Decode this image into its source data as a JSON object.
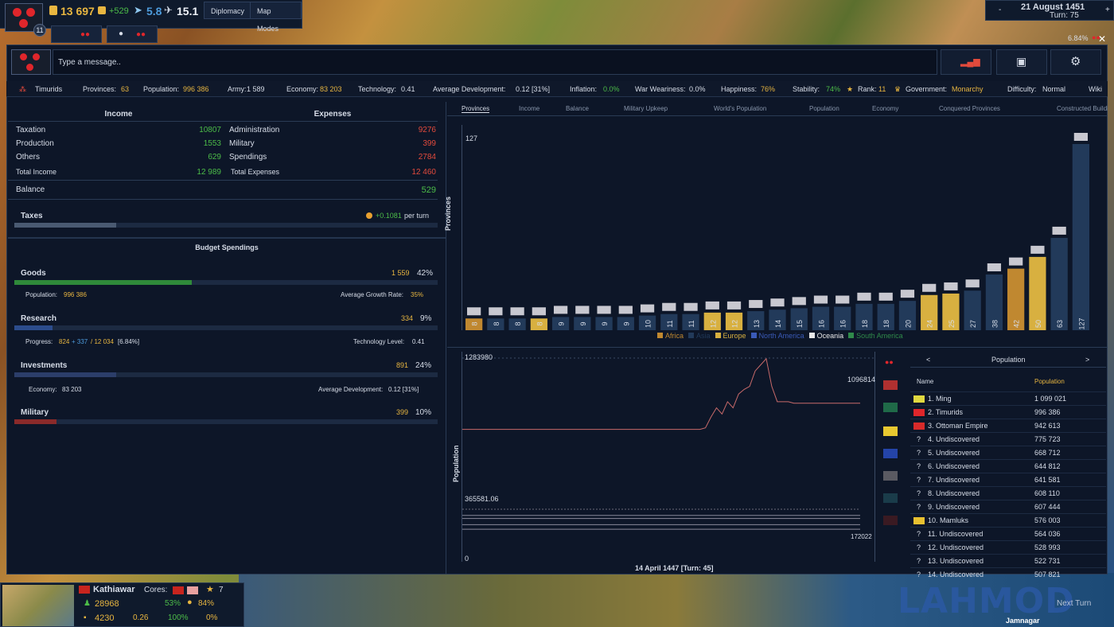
{
  "topbar": {
    "badge_count": "11",
    "gold": "13 697",
    "gold_delta": "+529",
    "manpower": "5.8",
    "morale": "15.1",
    "diplomacy_label": "Diplomacy",
    "map_modes_label": "Map Modes",
    "date": "21 August 1451",
    "turn": "Turn: 75",
    "percent": "6.84%"
  },
  "chat": {
    "placeholder": "Type a message.."
  },
  "stats": {
    "country": "Timurids",
    "provinces_label": "Provinces:",
    "provinces": "63",
    "population_label": "Population:",
    "population": "996 386",
    "army_label": "Army:",
    "army": "1 589",
    "economy_label": "Economy:",
    "economy": "83 203",
    "technology_label": "Technology:",
    "technology": "0.41",
    "avg_dev_label": "Average Development:",
    "avg_dev": "0.12 [31%]",
    "inflation_label": "Inflation:",
    "inflation": "0.0%",
    "war_label": "War Weariness:",
    "war": "0.0%",
    "happiness_label": "Happiness:",
    "happiness": "76%",
    "stability_label": "Stability:",
    "stability": "74%",
    "rank_label": "Rank:",
    "rank": "11",
    "government_label": "Government:",
    "government": "Monarchy",
    "difficulty_label": "Difficulty:",
    "difficulty": "Normal",
    "wiki_label": "Wiki"
  },
  "budget": {
    "income_header": "Income",
    "expenses_header": "Expenses",
    "income": [
      {
        "label": "Taxation",
        "value": "10807"
      },
      {
        "label": "Production",
        "value": "1553"
      },
      {
        "label": "Others",
        "value": "629"
      }
    ],
    "total_income_label": "Total Income",
    "total_income": "12 989",
    "expenses": [
      {
        "label": "Administration",
        "value": "9276"
      },
      {
        "label": "Military",
        "value": "399"
      },
      {
        "label": "Spendings",
        "value": "2784"
      }
    ],
    "total_expenses_label": "Total Expenses",
    "total_expenses": "12 460",
    "balance_label": "Balance",
    "balance": "529",
    "taxes_label": "Taxes",
    "taxes_value": "+0.1081",
    "taxes_suffix": "per turn",
    "taxes_fill": 0.24,
    "spendings_header": "Budget Spendings",
    "goods": {
      "label": "Goods",
      "amount": "1 559",
      "pct": "42%",
      "fill": 0.42,
      "sub_left_label": "Population:",
      "sub_left": "996 386",
      "sub_right_label": "Average Growth Rate:",
      "sub_right": "35%"
    },
    "research": {
      "label": "Research",
      "amount": "334",
      "pct": "9%",
      "fill": 0.09,
      "progress_label": "Progress:",
      "progress_a": "824",
      "progress_b": "+ 337",
      "progress_c": "/ 12 034",
      "progress_pct": "[6.84%]",
      "tech_label": "Technology Level:",
      "tech_value": "0.41"
    },
    "investments": {
      "label": "Investments",
      "amount": "891",
      "pct": "24%",
      "fill": 0.24,
      "sub_left_label": "Economy:",
      "sub_left": "83 203",
      "sub_right_label": "Average Development:",
      "sub_right": "0.12 [31%]"
    },
    "military": {
      "label": "Military",
      "amount": "399",
      "pct": "10%",
      "fill": 0.1
    }
  },
  "right_tabs": [
    "Provinces",
    "Income",
    "Balance",
    "Military Upkeep",
    "World's Population",
    "Population",
    "Economy",
    "Conquered Provinces",
    "Constructed Buildings"
  ],
  "colors": {
    "africa": "#c08830",
    "asia": "#223a5a",
    "europe": "#d8b040",
    "north_america": "#3a5ab8",
    "oceania": "#e8e8e8",
    "south_america": "#2f8a4a"
  },
  "chart_data": [
    {
      "type": "bar",
      "ylabel": "Provinces",
      "ylim": [
        0,
        127
      ],
      "y_tick_label": "127",
      "categories": [
        "1",
        "2",
        "3",
        "4",
        "5",
        "6",
        "7",
        "8",
        "9",
        "10",
        "11",
        "12",
        "13",
        "14",
        "15",
        "16",
        "17",
        "18",
        "19",
        "20",
        "21",
        "22",
        "23",
        "24",
        "25",
        "26",
        "27",
        "28",
        "29",
        "30",
        "31"
      ],
      "values": [
        8,
        8,
        8,
        8,
        9,
        9,
        9,
        9,
        10,
        11,
        11,
        12,
        12,
        13,
        14,
        15,
        16,
        16,
        18,
        18,
        20,
        24,
        25,
        27,
        38,
        42,
        50,
        63,
        127
      ],
      "value_labels": [
        "8",
        "8",
        "8",
        "8",
        "9",
        "9",
        "9",
        "9",
        "10",
        "11",
        "11",
        "12",
        "12",
        "13",
        "14",
        "15",
        "16",
        "16",
        "18",
        "18",
        "20",
        "24",
        "25",
        "27",
        "38",
        "42",
        "50",
        "63",
        "127"
      ],
      "colors": [
        "#c08830",
        "#223a5a",
        "#223a5a",
        "#d8b040",
        "#223a5a",
        "#223a5a",
        "#223a5a",
        "#223a5a",
        "#223a5a",
        "#223a5a",
        "#223a5a",
        "#d8b040",
        "#d8b040",
        "#223a5a",
        "#223a5a",
        "#223a5a",
        "#223a5a",
        "#223a5a",
        "#223a5a",
        "#223a5a",
        "#223a5a",
        "#d8b040",
        "#d8b040",
        "#223a5a",
        "#223a5a",
        "#c08830",
        "#d8b040",
        "#223a5a",
        "#223a5a"
      ],
      "legend": [
        {
          "name": "Africa",
          "color": "#c08830"
        },
        {
          "name": "Asia",
          "color": "#223a5a"
        },
        {
          "name": "Europe",
          "color": "#d8b040"
        },
        {
          "name": "North America",
          "color": "#3a5ab8"
        },
        {
          "name": "Oceania",
          "color": "#e8e8e8"
        },
        {
          "name": "South America",
          "color": "#2f8a4a"
        }
      ]
    },
    {
      "type": "line",
      "ylabel": "Population",
      "ylim": [
        0,
        1283980
      ],
      "top_label": "1283980",
      "mid_label": "365581.06",
      "zero_label": "0",
      "xlabel": "14 April 1447 [Turn: 45]",
      "ann_1": "1096814",
      "ann_2": "172022",
      "series_main": [
        820000,
        820000,
        820000,
        820000,
        820000,
        820000,
        820000,
        820000,
        820000,
        820000,
        820000,
        820000,
        820000,
        820000,
        820000,
        820000,
        820000,
        820000,
        820000,
        820000,
        820000,
        820000,
        820000,
        820000,
        820000,
        820000,
        820000,
        820000,
        820000,
        820000,
        820000,
        820000,
        820000,
        820000,
        820000,
        820000,
        820000,
        820000,
        820000,
        820000,
        820000,
        820000,
        820000,
        820000,
        830000,
        900000,
        960000,
        920000,
        1000000,
        960000,
        1050000,
        1080000,
        1100000,
        1200000,
        1240000,
        1280000,
        1100000,
        1000000,
        1000000,
        1000000,
        990000,
        990000,
        990000,
        990000,
        990000,
        990000,
        990000,
        990000,
        990000,
        990000,
        990000,
        990000,
        990000
      ],
      "series_lines": [
        300000,
        260000,
        240000,
        200000,
        170000
      ]
    }
  ],
  "table": {
    "nav_prev": "<",
    "nav_next": ">",
    "nav_title": "Population",
    "col_name": "Name",
    "col_value": "Population",
    "rows": [
      {
        "name": "1. Ming",
        "value": "1 099 021",
        "flag": "#e0d840"
      },
      {
        "name": "2. Timurids",
        "value": "996 386",
        "flag": "#e0262b"
      },
      {
        "name": "3. Ottoman Empire",
        "value": "942 613",
        "flag": "#d82a2a"
      },
      {
        "name": "4. Undiscovered",
        "value": "775 723",
        "flag": "?"
      },
      {
        "name": "5. Undiscovered",
        "value": "668 712",
        "flag": "?"
      },
      {
        "name": "6. Undiscovered",
        "value": "644 812",
        "flag": "?"
      },
      {
        "name": "7. Undiscovered",
        "value": "641 581",
        "flag": "?"
      },
      {
        "name": "8. Undiscovered",
        "value": "608 110",
        "flag": "?"
      },
      {
        "name": "9. Undiscovered",
        "value": "607 444",
        "flag": "?"
      },
      {
        "name": "10. Mamluks",
        "value": "576 003",
        "flag": "#e8c030"
      },
      {
        "name": "11. Undiscovered",
        "value": "564 036",
        "flag": "?"
      },
      {
        "name": "12. Undiscovered",
        "value": "528 993",
        "flag": "?"
      },
      {
        "name": "13. Undiscovered",
        "value": "522 731",
        "flag": "?"
      },
      {
        "name": "14. Undiscovered",
        "value": "507 821",
        "flag": "?"
      }
    ]
  },
  "province": {
    "name": "Kathiawar",
    "cores_label": "Cores:",
    "stars": "7",
    "population": "28968",
    "happiness": "53%",
    "happiness2": "84%",
    "income": "4230",
    "dev": "0.26",
    "stability": "100%",
    "unrest": "0%"
  },
  "bottom_right": {
    "province": "Jamnagar",
    "next_turn": "Next Turn"
  },
  "watermark": "LAHMOD"
}
